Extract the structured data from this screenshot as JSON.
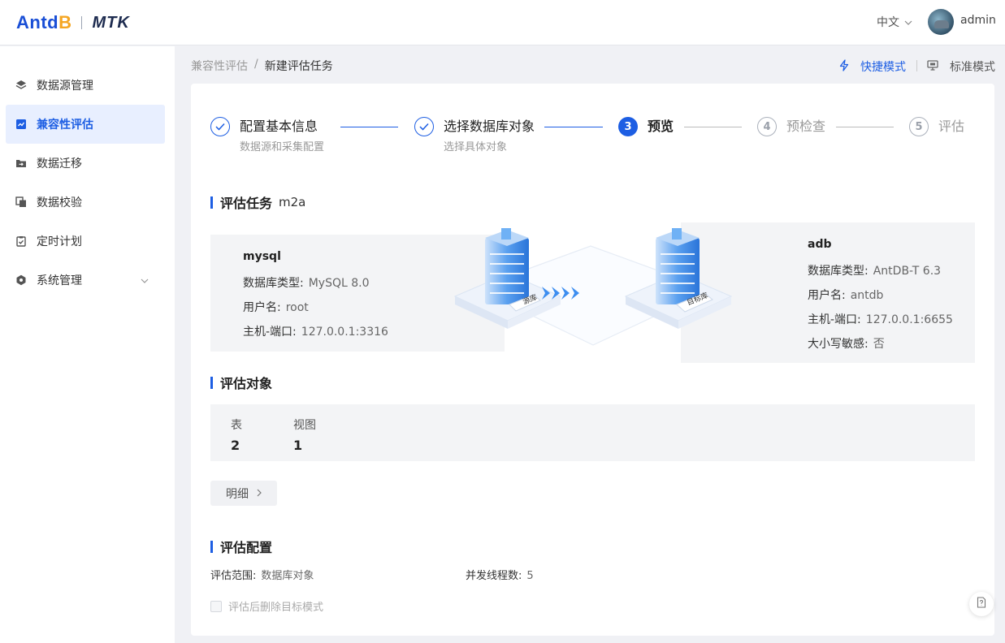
{
  "header": {
    "logo_antdb_pre": "Antd",
    "logo_antdb_mid": "B",
    "logo_mtk": "MTK",
    "language": "中文",
    "username": "admin"
  },
  "sidebar": {
    "items": [
      {
        "label": "数据源管理",
        "icon": "layers-icon"
      },
      {
        "label": "兼容性评估",
        "icon": "assessment-icon",
        "active": true
      },
      {
        "label": "数据迁移",
        "icon": "folder-arrow-icon"
      },
      {
        "label": "数据校验",
        "icon": "copy-icon"
      },
      {
        "label": "定时计划",
        "icon": "clipboard-check-icon"
      },
      {
        "label": "系统管理",
        "icon": "hexagon-gear-icon"
      }
    ]
  },
  "breadcrumb": {
    "parent": "兼容性评估",
    "separator": "/",
    "current": "新建评估任务"
  },
  "modes": {
    "quick": "快捷模式",
    "standard": "标准模式"
  },
  "steps": [
    {
      "number": "1",
      "title": "配置基本信息",
      "desc": "数据源和采集配置",
      "status": "done"
    },
    {
      "number": "2",
      "title": "选择数据库对象",
      "desc": "选择具体对象",
      "status": "done"
    },
    {
      "number": "3",
      "title": "预览",
      "desc": "",
      "status": "active"
    },
    {
      "number": "4",
      "title": "预检查",
      "desc": "",
      "status": "wait"
    },
    {
      "number": "5",
      "title": "评估",
      "desc": "",
      "status": "wait"
    }
  ],
  "task": {
    "heading": "评估任务",
    "name": "m2a"
  },
  "source": {
    "name": "mysql",
    "db_type_label": "数据库类型:",
    "db_type": "MySQL 8.0",
    "user_label": "用户名:",
    "user": "root",
    "host_label": "主机-端口:",
    "host": "127.0.0.1:3316"
  },
  "target": {
    "name": "adb",
    "db_type_label": "数据库类型:",
    "db_type": "AntDB-T 6.3",
    "user_label": "用户名:",
    "user": "antdb",
    "host_label": "主机-端口:",
    "host": "127.0.0.1:6655",
    "case_label": "大小写敏感:",
    "case": "否"
  },
  "illustration": {
    "source_tag": "源库",
    "target_tag": "目标库"
  },
  "objects": {
    "heading": "评估对象",
    "table_label": "表",
    "table_count": "2",
    "view_label": "视图",
    "view_count": "1",
    "detail_button": "明细"
  },
  "config": {
    "heading": "评估配置",
    "scope_label": "评估范围:",
    "scope": "数据库对象",
    "threads_label": "并发线程数:",
    "threads": "5",
    "drop_schema_label": "评估后删除目标模式"
  },
  "colors": {
    "primary": "#1d5ee3",
    "active_bg": "#e8efff",
    "panel_bg": "#f3f4f6",
    "page_bg": "#f0f1f5"
  }
}
